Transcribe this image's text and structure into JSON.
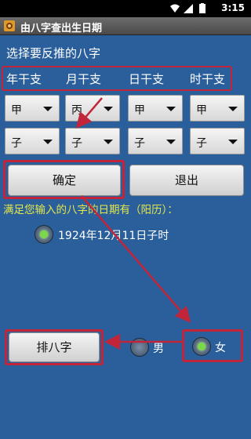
{
  "status_bar": {
    "time": "3:15"
  },
  "window": {
    "title": "由八字查出生日期"
  },
  "prompt": "选择要反推的八字",
  "columns": [
    {
      "label": "年干支",
      "stem": "甲",
      "branch": "子"
    },
    {
      "label": "月干支",
      "stem": "丙",
      "branch": "子"
    },
    {
      "label": "日干支",
      "stem": "甲",
      "branch": "子"
    },
    {
      "label": "时干支",
      "stem": "甲",
      "branch": "子"
    }
  ],
  "buttons": {
    "confirm": "确定",
    "exit": "退出",
    "arrange": "排八字"
  },
  "result": {
    "label": "满足您输入的八字的日期有（阳历）：",
    "options": [
      {
        "text": "1924年12月11日子时",
        "selected": true
      }
    ]
  },
  "gender": {
    "male": {
      "label": "男",
      "selected": false
    },
    "female": {
      "label": "女",
      "selected": true
    }
  },
  "colors": {
    "background": "#2a5f9b",
    "annotation": "#c2253a",
    "result_label": "#e6e84a",
    "radio_selected": "#7bd84a"
  }
}
